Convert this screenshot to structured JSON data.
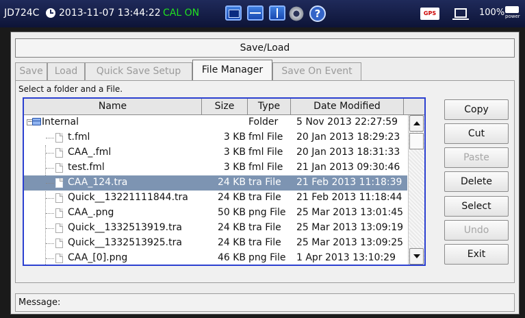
{
  "status_bar": {
    "model": "JD724C",
    "datetime": "2013-11-07 13:44:22",
    "cal_status": "CAL ON",
    "gps_label": "GPS",
    "battery_percent": "100%",
    "power_label": "power",
    "help_glyph": "?"
  },
  "dialog": {
    "title": "Save/Load",
    "tabs": [
      {
        "label": "Save",
        "active": false
      },
      {
        "label": "Load",
        "active": false
      },
      {
        "label": "Quick Save Setup",
        "active": false
      },
      {
        "label": "File Manager",
        "active": true
      },
      {
        "label": "Save On Event",
        "active": false
      }
    ],
    "hint": "Select a folder and a File.",
    "columns": [
      "Name",
      "Size",
      "Type",
      "Date Modified"
    ],
    "folder": {
      "name": "Internal",
      "size": "",
      "type": "Folder",
      "date": "5 Nov 2013 22:27:59",
      "icon": "folder-icon",
      "expander": "−"
    },
    "files": [
      {
        "name": "t.fml",
        "size": "3 KB",
        "type": "fml File",
        "date": "20 Jan 2013 18:29:23"
      },
      {
        "name": "CAA_.fml",
        "size": "3 KB",
        "type": "fml File",
        "date": "20 Jan 2013 18:31:33"
      },
      {
        "name": "test.fml",
        "size": "3 KB",
        "type": "fml File",
        "date": "21 Jan 2013 09:30:46"
      },
      {
        "name": "CAA_124.tra",
        "size": "24 KB",
        "type": "tra File",
        "date": "21 Feb 2013 11:18:39",
        "selected": true
      },
      {
        "name": "Quick__13221111844.tra",
        "size": "24 KB",
        "type": "tra File",
        "date": "21 Feb 2013 11:18:44"
      },
      {
        "name": "CAA_.png",
        "size": "50 KB",
        "type": "png File",
        "date": "25 Mar 2013 13:01:45"
      },
      {
        "name": "Quick__1332513919.tra",
        "size": "24 KB",
        "type": "tra File",
        "date": "25 Mar 2013 13:09:19"
      },
      {
        "name": "Quick__1332513925.tra",
        "size": "24 KB",
        "type": "tra File",
        "date": "25 Mar 2013 13:09:25"
      },
      {
        "name": "CAA_[0].png",
        "size": "46 KB",
        "type": "png File",
        "date": "1 Apr 2013 13:10:29"
      }
    ],
    "buttons": [
      {
        "label": "Copy",
        "enabled": true
      },
      {
        "label": "Cut",
        "enabled": true
      },
      {
        "label": "Paste",
        "enabled": false
      },
      {
        "label": "Delete",
        "enabled": true
      },
      {
        "label": "Select",
        "enabled": true
      },
      {
        "label": "Undo",
        "enabled": false
      },
      {
        "label": "Exit",
        "enabled": true
      }
    ],
    "message_label": "Message:"
  },
  "colors": {
    "selection": "#7d94b2",
    "listbox_border": "#2a3fd0",
    "cal_on": "#20e020",
    "statusbar": "#1f2a5a"
  }
}
